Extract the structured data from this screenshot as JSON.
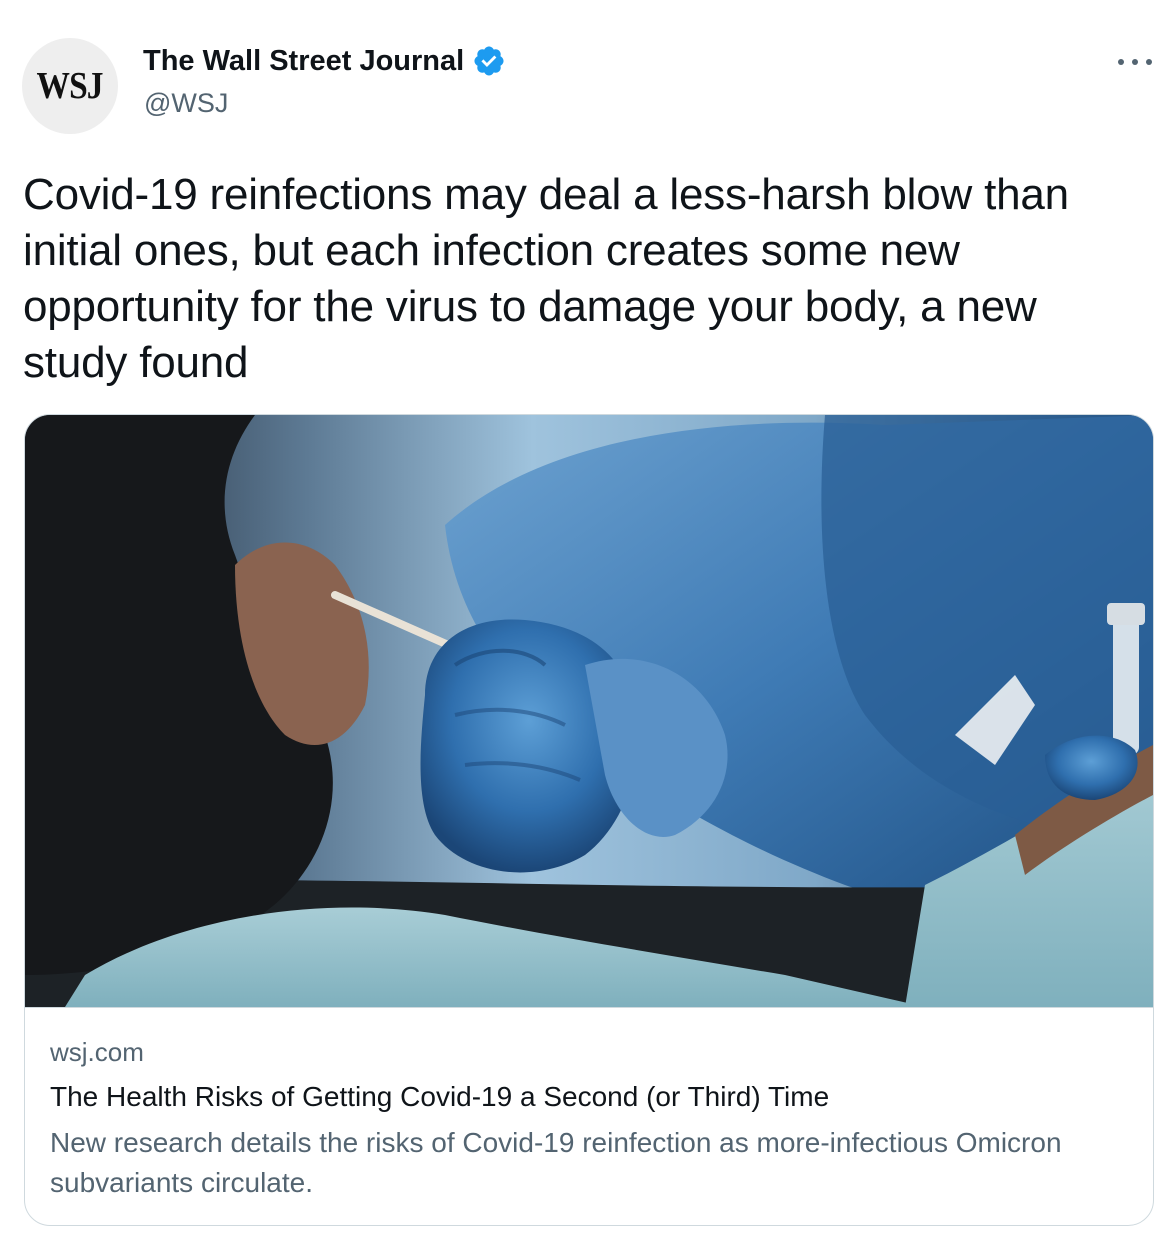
{
  "author": {
    "avatar_text": "WSJ",
    "name": "The Wall Street Journal",
    "handle": "@WSJ",
    "verified_color": "#1d9bf0"
  },
  "tweet": {
    "text": "Covid-19 reinfections may deal a less-harsh blow than initial ones, but each infection creates some new opportunity for the virus to damage your body, a new study found"
  },
  "card": {
    "domain": "wsj.com",
    "title": "The Health Risks of Getting Covid-19 a Second (or Third) Time",
    "description": "New research details the risks of Covid-19 reinfection as more-infectious Omicron subvariants circulate."
  },
  "colors": {
    "text_primary": "#0f1419",
    "text_secondary": "#536471",
    "border": "#cfd9de",
    "accent": "#1d9bf0"
  },
  "icons": {
    "more": "more-options-icon",
    "verified": "verified-badge-icon"
  }
}
